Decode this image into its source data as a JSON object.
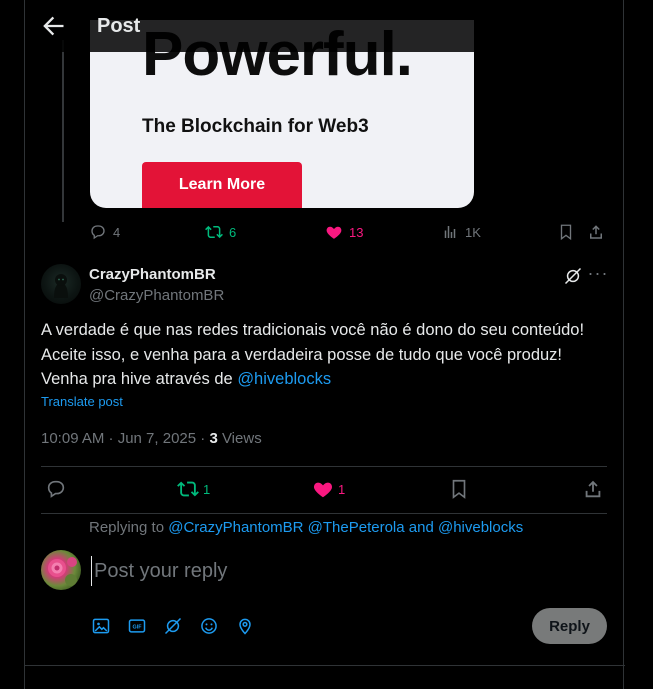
{
  "header": {
    "title": "Post"
  },
  "ad": {
    "headline": "Powerful.",
    "subline": "The Blockchain for Web3",
    "button_label": "Learn More"
  },
  "quoted_actions": {
    "replies": "4",
    "reposts": "6",
    "likes": "13",
    "views": "1K"
  },
  "post": {
    "display_name": "CrazyPhantomBR",
    "handle": "@CrazyPhantomBR",
    "text_main": "A verdade é que nas redes tradicionais você não é dono do seu conteúdo! Aceite isso, e venha para a verdadeira posse de tudo que você produz! Venha pra hive através de ",
    "text_mention": "@hiveblocks",
    "translate_label": "Translate post",
    "timestamp": "10:09 AM · Jun 7, 2025 · ",
    "views_count": "3",
    "views_label": " Views"
  },
  "post_actions": {
    "reposts": "1",
    "likes": "1"
  },
  "reply": {
    "replying_prefix": "Replying to ",
    "replying_mentions": "@CrazyPhantomBR @ThePeterola and @hiveblocks",
    "placeholder": "Post your reply",
    "button_label": "Reply"
  },
  "colors": {
    "accent": "#1d9bf0",
    "repost_green": "#00ba7c",
    "like_pink": "#f91880",
    "muted": "#71767b",
    "ad_red": "#e31337"
  },
  "icons": {
    "back": "arrow-left-icon",
    "reply": "speech-bubble-icon",
    "repost": "repost-arrows-icon",
    "like": "heart-icon",
    "views": "bar-chart-icon",
    "bookmark": "bookmark-icon",
    "share": "share-upload-icon",
    "grok": "grok-icon",
    "more": "ellipsis-icon",
    "media": "image-icon",
    "gif": "gif-icon",
    "grok_tool": "grok-icon",
    "emoji": "smiley-icon",
    "location": "location-pin-icon"
  }
}
